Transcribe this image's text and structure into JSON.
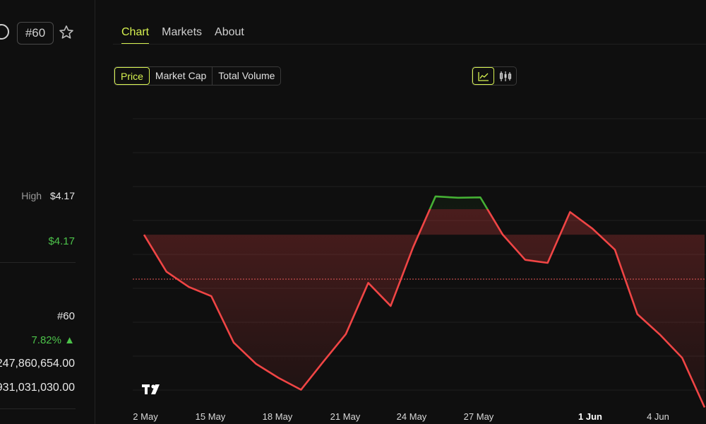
{
  "left_panel": {
    "rank": "#60",
    "high_label": "High",
    "high_value": "$4.17",
    "price": "$4.17",
    "rank_stat": "#60",
    "change": "7.82% ▲",
    "market_cap": "247,860,654.00",
    "volume": "931,031,030.00"
  },
  "tabs": [
    "Chart",
    "Markets",
    "About"
  ],
  "segments": [
    "Price",
    "Market Cap",
    "Total Volume"
  ],
  "chart_toggle": {
    "line_icon": "line-chart-icon",
    "candle_icon": "candlestick-icon"
  },
  "colors": {
    "accent": "#d7f250",
    "up": "#45b034",
    "down": "#f04545",
    "baseline": "#e85a5a"
  },
  "chart_data": {
    "type": "line",
    "x_tick_labels": [
      "2 May",
      "15 May",
      "18 May",
      "21 May",
      "24 May",
      "27 May",
      "1 Jun",
      "4 Jun"
    ],
    "bold_tick": "1 Jun",
    "baseline_value": 0.558,
    "ylim": [
      0,
      1
    ],
    "points": [
      [
        0.0,
        0.558
      ],
      [
        1,
        0.449
      ],
      [
        2,
        0.404
      ],
      [
        3,
        0.377
      ],
      [
        4,
        0.24
      ],
      [
        5,
        0.177
      ],
      [
        6,
        0.136
      ],
      [
        7,
        0.101
      ],
      [
        8,
        0.184
      ],
      [
        9,
        0.265
      ],
      [
        10,
        0.416
      ],
      [
        11,
        0.348
      ],
      [
        12,
        0.521
      ],
      [
        13,
        0.671
      ],
      [
        14,
        0.667
      ],
      [
        15,
        0.668
      ],
      [
        16,
        0.558
      ],
      [
        17,
        0.484
      ],
      [
        18,
        0.475
      ],
      [
        19,
        0.625
      ],
      [
        20,
        0.576
      ],
      [
        21,
        0.514
      ],
      [
        22,
        0.324
      ],
      [
        23,
        0.264
      ],
      [
        24,
        0.195
      ],
      [
        25,
        0.049
      ]
    ],
    "grid": true,
    "watermark": "TV"
  }
}
